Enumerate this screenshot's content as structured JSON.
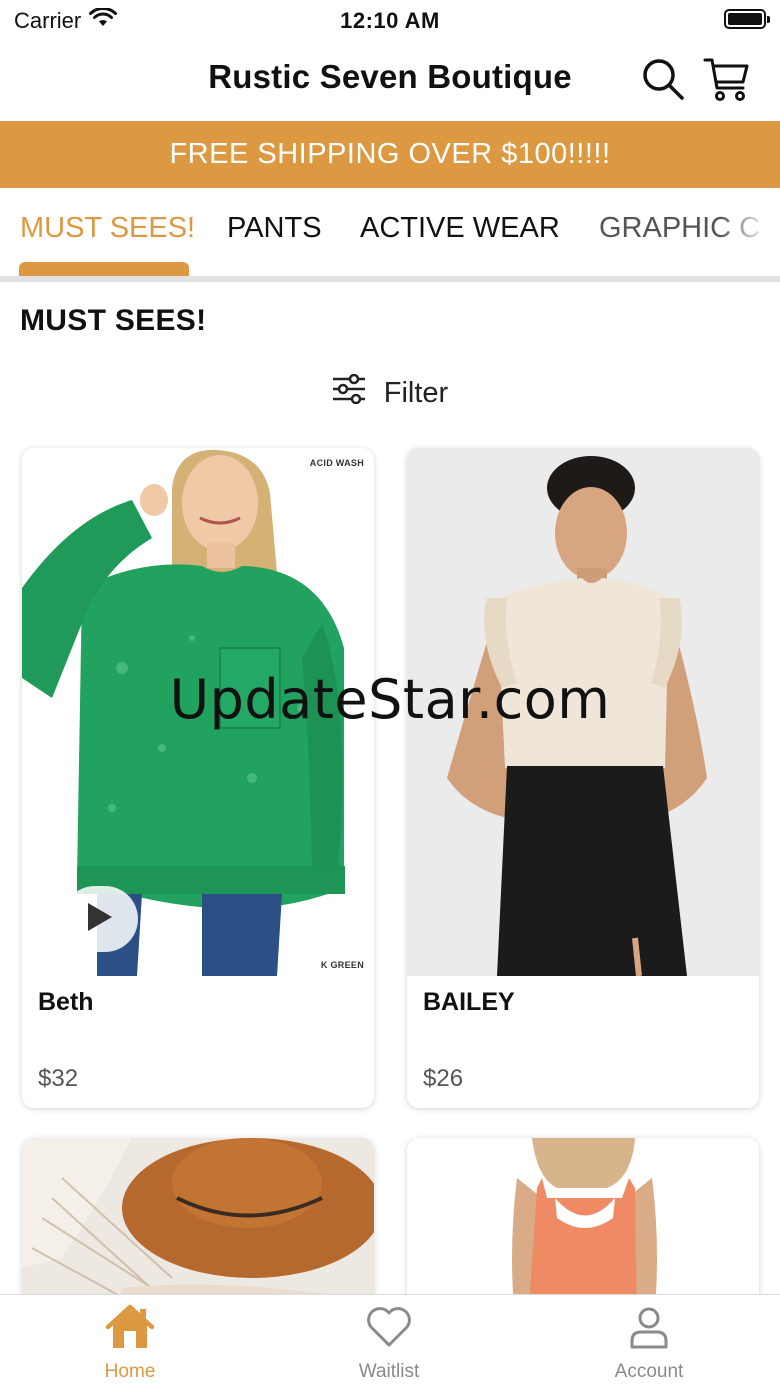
{
  "status_bar": {
    "carrier": "Carrier",
    "time": "12:10 AM"
  },
  "header": {
    "title": "Rustic Seven Boutique",
    "icons": [
      "search-icon",
      "cart-icon"
    ]
  },
  "banner": {
    "text": "FREE SHIPPING OVER $100!!!!!"
  },
  "tabs": [
    {
      "label": "MUST SEES!",
      "active": true
    },
    {
      "label": "PANTS",
      "active": false
    },
    {
      "label": "ACTIVE WEAR",
      "active": false
    },
    {
      "label": "GRAPHIC C",
      "active": false
    }
  ],
  "section": {
    "title": "MUST SEES!"
  },
  "filter": {
    "label": "Filter",
    "icon": "sliders-icon"
  },
  "products": [
    {
      "name": "Beth",
      "price": "$32",
      "tag_top": "ACID WASH",
      "tag_bottom": "K GREEN",
      "has_video": true
    },
    {
      "name": "BAILEY",
      "price": "$26"
    },
    {
      "name": "",
      "price": ""
    },
    {
      "name": "",
      "price": ""
    }
  ],
  "watermark": "UpdateStar.com",
  "bottom_nav": [
    {
      "label": "Home",
      "icon": "home-icon",
      "active": true
    },
    {
      "label": "Waitlist",
      "icon": "heart-icon",
      "active": false
    },
    {
      "label": "Account",
      "icon": "user-icon",
      "active": false
    }
  ],
  "colors": {
    "accent": "#dc9941",
    "text": "#111111",
    "inactive": "#8a8a8a"
  }
}
